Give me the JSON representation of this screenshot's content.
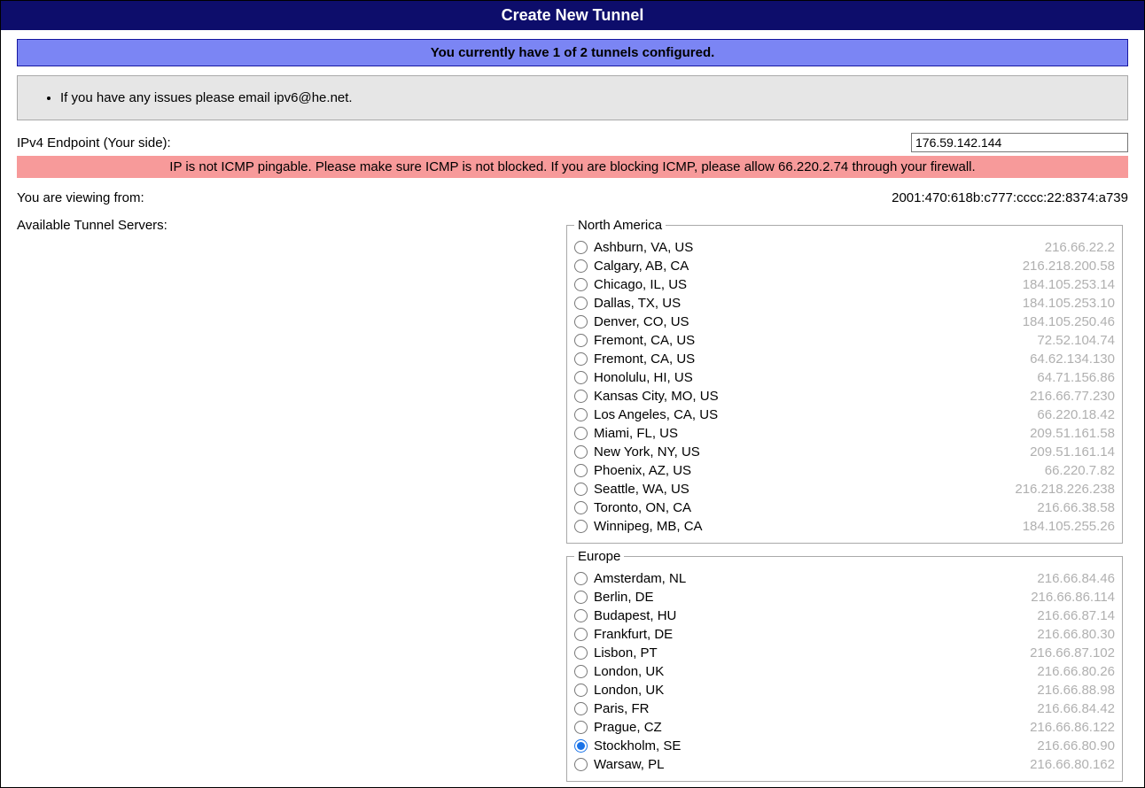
{
  "header": {
    "title": "Create New Tunnel"
  },
  "status_banner": "You currently have 1 of 2 tunnels configured.",
  "notice_items": [
    "If you have any issues please email ipv6@he.net."
  ],
  "ipv4_endpoint": {
    "label": "IPv4 Endpoint (Your side):",
    "value": "176.59.142.144"
  },
  "error_banner": "IP is not ICMP pingable. Please make sure ICMP is not blocked. If you are blocking ICMP, please allow 66.220.2.74 through your firewall.",
  "viewing": {
    "label": "You are viewing from:",
    "value": "2001:470:618b:c777:cccc:22:8374:a739"
  },
  "servers_label": "Available Tunnel Servers:",
  "regions": [
    {
      "name": "North America",
      "servers": [
        {
          "city": "Ashburn, VA, US",
          "ip": "216.66.22.2",
          "selected": false
        },
        {
          "city": "Calgary, AB, CA",
          "ip": "216.218.200.58",
          "selected": false
        },
        {
          "city": "Chicago, IL, US",
          "ip": "184.105.253.14",
          "selected": false
        },
        {
          "city": "Dallas, TX, US",
          "ip": "184.105.253.10",
          "selected": false
        },
        {
          "city": "Denver, CO, US",
          "ip": "184.105.250.46",
          "selected": false
        },
        {
          "city": "Fremont, CA, US",
          "ip": "72.52.104.74",
          "selected": false
        },
        {
          "city": "Fremont, CA, US",
          "ip": "64.62.134.130",
          "selected": false
        },
        {
          "city": "Honolulu, HI, US",
          "ip": "64.71.156.86",
          "selected": false
        },
        {
          "city": "Kansas City, MO, US",
          "ip": "216.66.77.230",
          "selected": false
        },
        {
          "city": "Los Angeles, CA, US",
          "ip": "66.220.18.42",
          "selected": false
        },
        {
          "city": "Miami, FL, US",
          "ip": "209.51.161.58",
          "selected": false
        },
        {
          "city": "New York, NY, US",
          "ip": "209.51.161.14",
          "selected": false
        },
        {
          "city": "Phoenix, AZ, US",
          "ip": "66.220.7.82",
          "selected": false
        },
        {
          "city": "Seattle, WA, US",
          "ip": "216.218.226.238",
          "selected": false
        },
        {
          "city": "Toronto, ON, CA",
          "ip": "216.66.38.58",
          "selected": false
        },
        {
          "city": "Winnipeg, MB, CA",
          "ip": "184.105.255.26",
          "selected": false
        }
      ]
    },
    {
      "name": "Europe",
      "servers": [
        {
          "city": "Amsterdam, NL",
          "ip": "216.66.84.46",
          "selected": false
        },
        {
          "city": "Berlin, DE",
          "ip": "216.66.86.114",
          "selected": false
        },
        {
          "city": "Budapest, HU",
          "ip": "216.66.87.14",
          "selected": false
        },
        {
          "city": "Frankfurt, DE",
          "ip": "216.66.80.30",
          "selected": false
        },
        {
          "city": "Lisbon, PT",
          "ip": "216.66.87.102",
          "selected": false
        },
        {
          "city": "London, UK",
          "ip": "216.66.80.26",
          "selected": false
        },
        {
          "city": "London, UK",
          "ip": "216.66.88.98",
          "selected": false
        },
        {
          "city": "Paris, FR",
          "ip": "216.66.84.42",
          "selected": false
        },
        {
          "city": "Prague, CZ",
          "ip": "216.66.86.122",
          "selected": false
        },
        {
          "city": "Stockholm, SE",
          "ip": "216.66.80.90",
          "selected": true
        },
        {
          "city": "Warsaw, PL",
          "ip": "216.66.80.162",
          "selected": false
        }
      ]
    }
  ]
}
